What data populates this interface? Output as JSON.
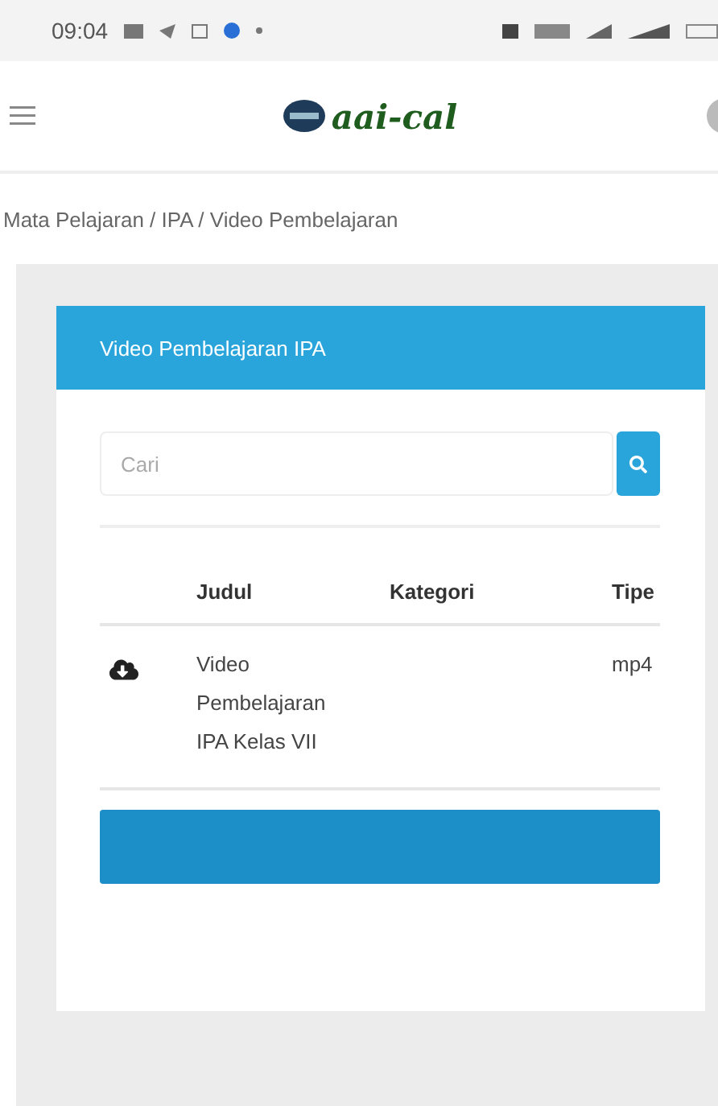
{
  "status_bar": {
    "time": "09:04"
  },
  "header": {
    "logo_text": "aai-cal"
  },
  "breadcrumb": "Mata Pelajaran / IPA / Video Pembelajaran",
  "card": {
    "title": "Video Pembelajaran IPA",
    "search": {
      "placeholder": "Cari"
    },
    "table": {
      "columns": [
        "Judul",
        "Kategori",
        "Tipe"
      ],
      "rows": [
        {
          "title": "Video Pembelajaran IPA Kelas VII",
          "type": "mp4"
        }
      ]
    }
  }
}
